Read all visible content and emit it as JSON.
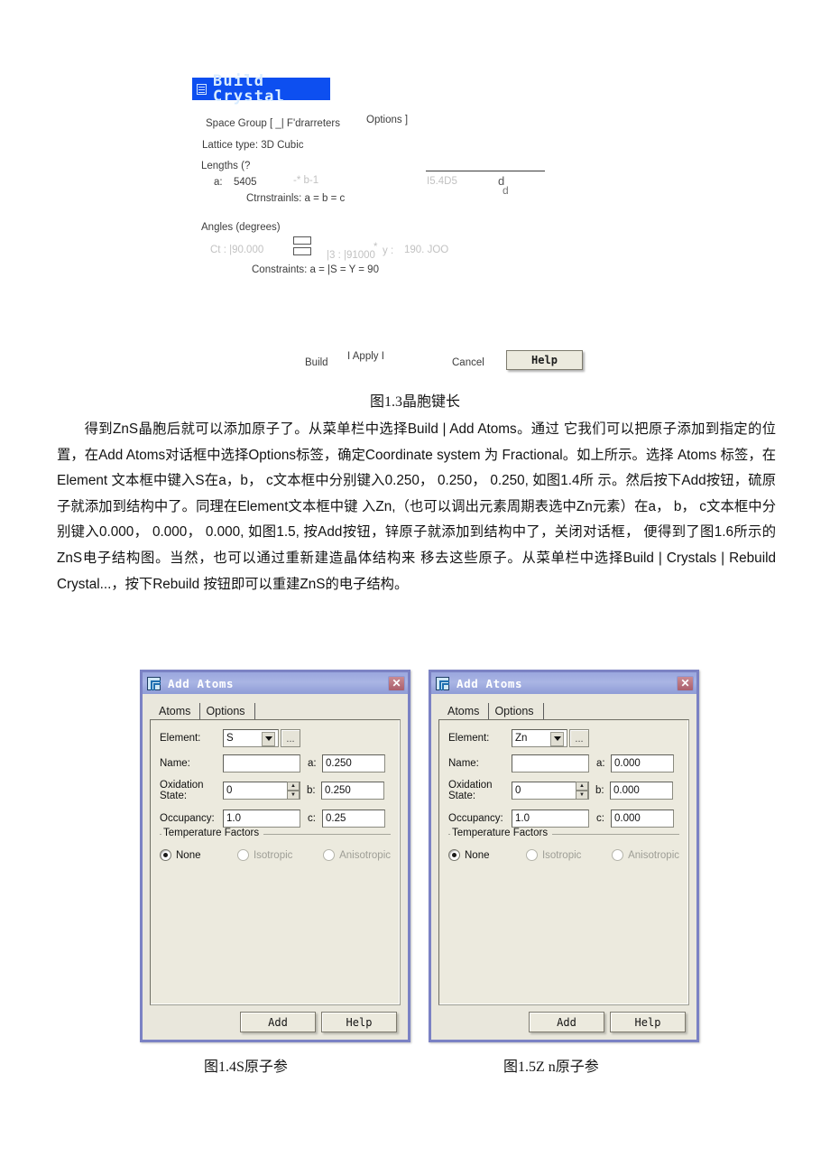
{
  "build_crystal": {
    "window_title": "Build Crystal",
    "window_icon": "window-list-icon",
    "title_bar_color": "#0d4ff0",
    "title_text_color": "#d9ecff",
    "tab_space_group": "Space Group [ _| F'drarreters",
    "tab_options": "Options ]",
    "lattice_type": "Lattice type: 3D Cubic",
    "lengths_header": "Lengths (?",
    "a_label": "a:",
    "a_value": "5405",
    "b_ghost": "-* b-1",
    "c_ghost": "I5.4D5",
    "c_unit_ghost_1": "d",
    "c_unit_ghost_2": "d",
    "length_constraints": "Ctrnstrainls: a = b = c",
    "angles_header": "Angles (degrees)",
    "alpha_ghost": "Ct : |90.000",
    "beta_ghost": "|3 : |91000",
    "beta_prefix_ghost": "*",
    "gamma_ghost": "y :",
    "gamma_value_ghost": "190. JOO",
    "angle_constraints": "Constraints: a = |S = Y = 90",
    "btn_build": "Build",
    "btn_apply": "I Apply I",
    "btn_cancel": "Cancel",
    "btn_help": "Help"
  },
  "figure_1_3_caption": "图1.3晶胞键长",
  "prose": {
    "paragraph": "得到ZnS晶胞后就可以添加原子了。从菜单栏中选择Build | Add Atoms。通过 它我们可以把原子添加到指定的位置，在Add Atoms对话框中选择Options标签，确定Coordinate system 为 Fractional。如上所示。选择 Atoms 标签，在 Element 文本框中键入S在a，b， c文本框中分别键入0.250， 0.250， 0.250, 如图1.4所 示。然后按下Add按钮，硫原子就添加到结构中了。同理在Element文本框中键 入Zn,（也可以调出元素周期表选中Zn元素）在a， b， c文本框中分别键入0.000， 0.000， 0.000, 如图1.5, 按Add按钮，锌原子就添加到结构中了，关闭对话框， 便得到了图1.6所示的ZnS电子结构图。当然，也可以通过重新建造晶体结构来 移去这些原子。从菜单栏中选择Build | Crystals | Rebuild Crystal...，按下Rebuild 按钮即可以重建ZnS的电子结构。"
  },
  "dialogs": [
    {
      "id": "add-atoms-s",
      "title": "Add Atoms",
      "icon": "cascade-window-icon",
      "close_label": "✕",
      "tabs": [
        "Atoms",
        "Options"
      ],
      "active_tab": "Atoms",
      "fields": {
        "element_label": "Element:",
        "element_value": "S",
        "browse_label": "...",
        "name_label": "Name:",
        "name_value": "",
        "oxidation_label": "Oxidation\nState:",
        "oxidation_value": "0",
        "occupancy_label": "Occupancy:",
        "occupancy_value": "1.0",
        "a_label": "a:",
        "a_value": "0.250",
        "b_label": "b:",
        "b_value": "0.250",
        "c_label": "c:",
        "c_value": "0.25"
      },
      "temperature_factors": {
        "group_title": "Temperature Factors",
        "options": [
          "None",
          "Isotropic",
          "Anisotropic"
        ],
        "selected": "None"
      },
      "buttons": [
        "Add",
        "Help"
      ],
      "caption": "图1.4S原子参"
    },
    {
      "id": "add-atoms-zn",
      "title": "Add Atoms",
      "icon": "cascade-window-icon",
      "close_label": "✕",
      "tabs": [
        "Atoms",
        "Options"
      ],
      "active_tab": "Atoms",
      "fields": {
        "element_label": "Element:",
        "element_value": "Zn",
        "browse_label": "...",
        "name_label": "Name:",
        "name_value": "",
        "oxidation_label": "Oxidation\nState:",
        "oxidation_value": "0",
        "occupancy_label": "Occupancy:",
        "occupancy_value": "1.0",
        "a_label": "a:",
        "a_value": "0.000",
        "b_label": "b:",
        "b_value": "0.000",
        "c_label": "c:",
        "c_value": "0.000"
      },
      "temperature_factors": {
        "group_title": "Temperature Factors",
        "options": [
          "None",
          "Isotropic",
          "Anisotropic"
        ],
        "selected": "None"
      },
      "buttons": [
        "Add",
        "Help"
      ],
      "caption": "图1.5Z n原子参"
    }
  ],
  "colors": {
    "dialog_border": "#7b82c4",
    "dialog_face": "#e9e7dc",
    "titlebar_gradient_top": "#9aa7de",
    "titlebar_gradient_bottom": "#8f9cd6",
    "close_button": "#ab5f6c",
    "build_crystal_titlebar": "#0d4ff0"
  }
}
